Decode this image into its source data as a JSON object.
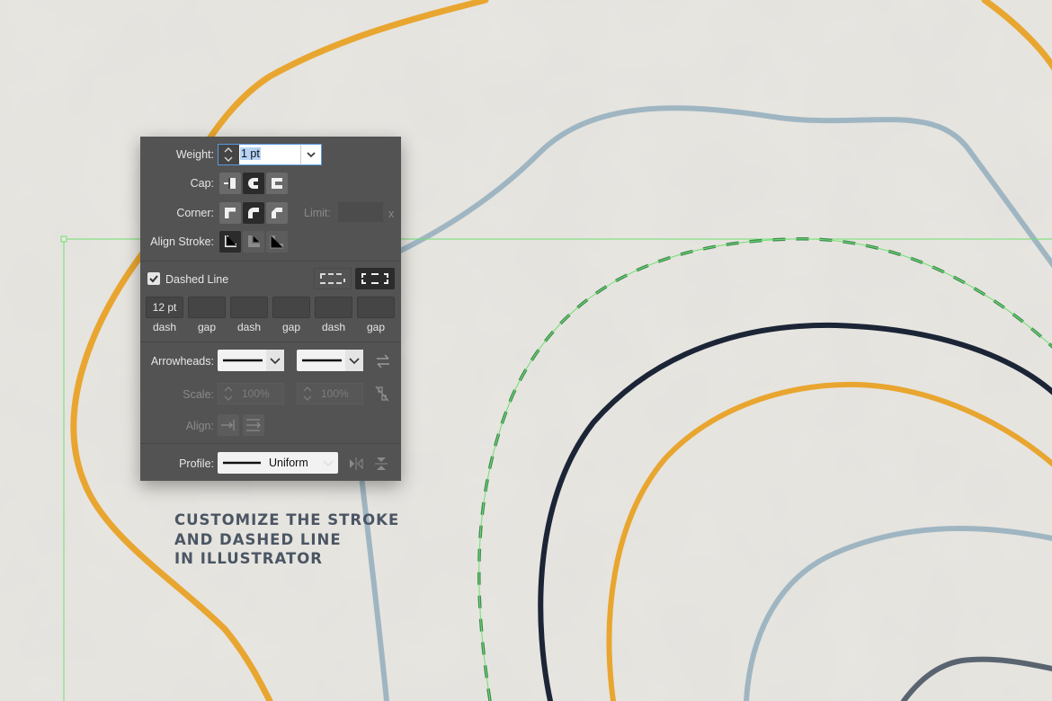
{
  "stroke_panel": {
    "weight": {
      "label": "Weight:",
      "value": "1 pt"
    },
    "cap": {
      "label": "Cap:",
      "options": [
        "butt-cap-icon",
        "round-cap-icon",
        "projecting-cap-icon"
      ],
      "selected": "round-cap-icon"
    },
    "corner": {
      "label": "Corner:",
      "options": [
        "miter-join-icon",
        "round-join-icon",
        "bevel-join-icon"
      ],
      "selected": "round-join-icon",
      "limit_label": "Limit:",
      "limit_unit": "x"
    },
    "align_stroke": {
      "label": "Align Stroke:",
      "options": [
        "align-center-icon",
        "align-inside-icon",
        "align-outside-icon"
      ],
      "selected": "align-center-icon"
    },
    "dashed_line": {
      "label": "Dashed Line",
      "checked": true,
      "fields": [
        {
          "value": "12 pt",
          "label": "dash"
        },
        {
          "value": "",
          "label": "gap"
        },
        {
          "value": "",
          "label": "dash"
        },
        {
          "value": "",
          "label": "gap"
        },
        {
          "value": "",
          "label": "dash"
        },
        {
          "value": "",
          "label": "gap"
        }
      ]
    },
    "arrowheads": {
      "label": "Arrowheads:"
    },
    "scale": {
      "label": "Scale:",
      "start_value": "100%",
      "end_value": "100%"
    },
    "align": {
      "label": "Align:"
    },
    "profile": {
      "label": "Profile:",
      "value": "Uniform"
    }
  },
  "caption": {
    "line1": "CUSTOMIZE THE STROKE",
    "line2": "AND DASHED LINE",
    "line3": "IN ILLUSTRATOR"
  },
  "colors": {
    "background": "#e8e6e1",
    "orange_stroke": "#e8a630",
    "blue_gray_stroke": "#9fb6c2",
    "navy_stroke": "#1b2536",
    "selection_green": "#6fe06f",
    "dash_green": "#3f8a52",
    "panel": "#535353",
    "caption_text": "#4b5664"
  }
}
